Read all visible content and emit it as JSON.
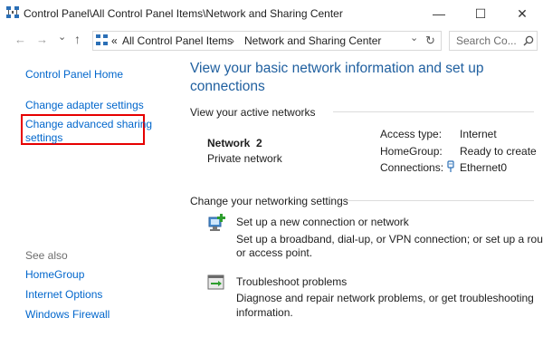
{
  "window": {
    "title": "Control Panel\\All Control Panel Items\\Network and Sharing Center",
    "minimize_glyph": "—",
    "maximize_glyph": "☐",
    "close_glyph": "✕"
  },
  "nav": {
    "back_glyph": "←",
    "forward_glyph": "→",
    "dropdown_glyph": "⌄",
    "up_glyph": "↑",
    "address_prefix": "«",
    "breadcrumb": [
      "All Control Panel Items",
      "Network and Sharing Center"
    ],
    "breadcrumb_sep": "›",
    "address_dropdown_glyph": "⌄",
    "refresh_glyph": "↻",
    "search_placeholder": "Search Co..."
  },
  "sidebar": {
    "home": "Control Panel Home",
    "adapter": "Change adapter settings",
    "advanced_line1": "Change advanced sharing",
    "advanced_line2": "settings",
    "see_also": "See also",
    "see_also_items": [
      "HomeGroup",
      "Internet Options",
      "Windows Firewall"
    ]
  },
  "main": {
    "heading_line1": "View your basic network information and set up",
    "heading_line2": "connections",
    "active_label": "View your active networks",
    "network_name": "Network  2",
    "network_type": "Private network",
    "access_type_label": "Access type:",
    "access_type_value": "Internet",
    "homegroup_label": "HomeGroup:",
    "homegroup_value": "Ready to create",
    "connections_label": "Connections:",
    "connections_value": "Ethernet0",
    "change_label": "Change your networking settings",
    "setup_title": "Set up a new connection or network",
    "setup_desc_line1": "Set up a broadband, dial-up, or VPN connection; or set up a router",
    "setup_desc_line2": "or access point.",
    "trouble_title": "Troubleshoot problems",
    "trouble_desc_line1": "Diagnose and repair network problems, or get troubleshooting",
    "trouble_desc_line2": "information."
  },
  "colors": {
    "link": "#0066cc",
    "heading": "#1f5f9f",
    "highlight_box": "#e60000"
  },
  "icons": [
    "network-sharing-icon",
    "ethernet-icon",
    "new-connection-icon",
    "troubleshoot-icon"
  ]
}
